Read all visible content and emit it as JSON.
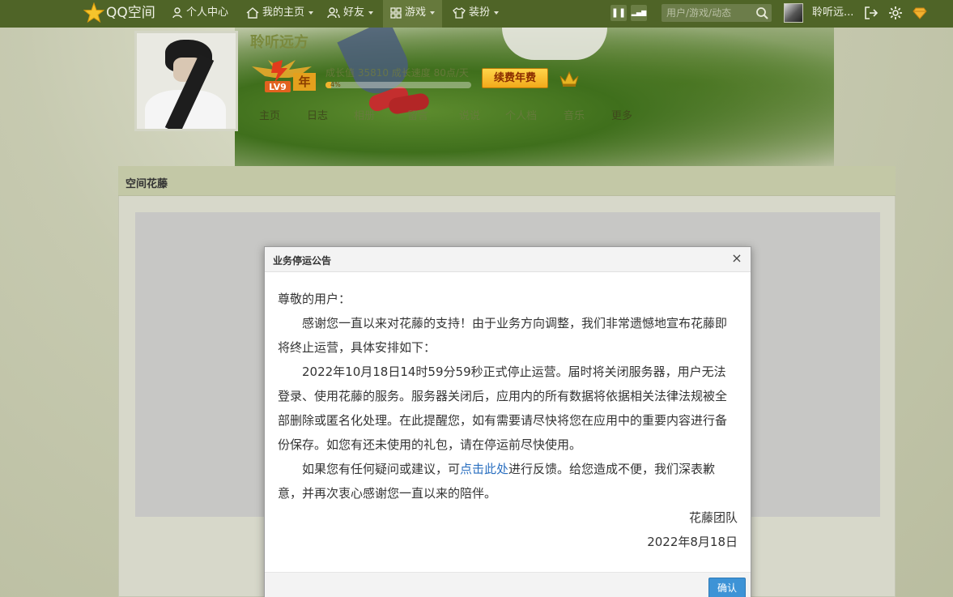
{
  "topbar": {
    "logo_text": "QQ空间",
    "nav": [
      {
        "label": "个人中心",
        "icon": "person-icon"
      },
      {
        "label": "我的主页",
        "icon": "home-icon"
      },
      {
        "label": "好友",
        "icon": "friends-icon"
      },
      {
        "label": "游戏",
        "icon": "grid-icon"
      },
      {
        "label": "装扮",
        "icon": "shirt-icon"
      }
    ],
    "search_placeholder": "用户/游戏/动态",
    "username": "聆听远...",
    "mini_buttons": [
      "❚❚",
      "▂▄▆"
    ]
  },
  "profile": {
    "name": "聆听远方",
    "level": "LV9",
    "year_tag": "年",
    "growth_text": "成长值 35810   成长速度 80点/天",
    "growth_percent": 4,
    "growth_percent_label": "4%",
    "renew_label": "续费年费",
    "nav": [
      "主页",
      "日志",
      "相册",
      "留言",
      "说说",
      "个人档",
      "音乐",
      "更多"
    ]
  },
  "panel": {
    "title": "空间花藤"
  },
  "modal": {
    "title": "业务停运公告",
    "close": "×",
    "greeting": "尊敬的用户：",
    "para1": "感谢您一直以来对花藤的支持！由于业务方向调整，我们非常遗憾地宣布花藤即将终止运营，具体安排如下：",
    "para2": "2022年10月18日14时59分59秒正式停止运营。届时将关闭服务器，用户无法登录、使用花藤的服务。服务器关闭后，应用内的所有数据将依据相关法律法规被全部删除或匿名化处理。在此提醒您，如有需要请尽快将您在应用中的重要内容进行备份保存。如您有还未使用的礼包，请在停运前尽快使用。",
    "para3_before": "如果您有任何疑问或建议，可",
    "para3_link": "点击此处",
    "para3_after": "进行反馈。给您造成不便，我们深表歉意，并再次衷心感谢您一直以来的陪伴。",
    "signature": "花藤团队",
    "date": "2022年8月18日",
    "ok_label": "确认"
  },
  "colors": {
    "topbar": "#4f6427",
    "accent_link": "#2a6fc0",
    "ok_button": "#3d93d6",
    "renew_button": "#f2a91a"
  }
}
